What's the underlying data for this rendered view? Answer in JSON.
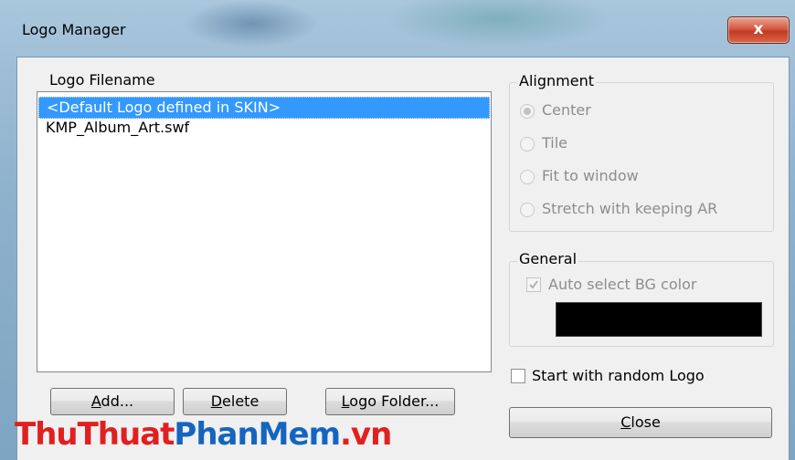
{
  "window": {
    "title": "Logo Manager",
    "close_glyph": "x"
  },
  "logo_list": {
    "header": "Logo Filename",
    "items": [
      {
        "label": "<Default Logo defined in SKIN>",
        "selected": true
      },
      {
        "label": "KMP_Album_Art.swf",
        "selected": false
      }
    ]
  },
  "buttons": {
    "add": "Add...",
    "delete": "Delete",
    "logo_folder": "Logo Folder...",
    "close": "Close"
  },
  "alignment": {
    "title": "Alignment",
    "options": [
      {
        "label": "Center",
        "checked": true,
        "enabled": false
      },
      {
        "label": "Tile",
        "checked": false,
        "enabled": false
      },
      {
        "label": "Fit to window",
        "checked": false,
        "enabled": false
      },
      {
        "label": "Stretch with keeping AR",
        "checked": false,
        "enabled": false
      }
    ]
  },
  "general": {
    "title": "General",
    "auto_bg_label": "Auto select BG color",
    "auto_bg_checked": true,
    "bg_color": "#000000"
  },
  "random_logo": {
    "label": "Start with random Logo",
    "checked": false
  },
  "watermark": {
    "part1": "ThuThuat",
    "part2": "PhanMem",
    "part3": ".vn"
  },
  "colors": {
    "selection": "#3399ff",
    "watermark_red": "#e02020",
    "watermark_blue": "#1565c0"
  }
}
